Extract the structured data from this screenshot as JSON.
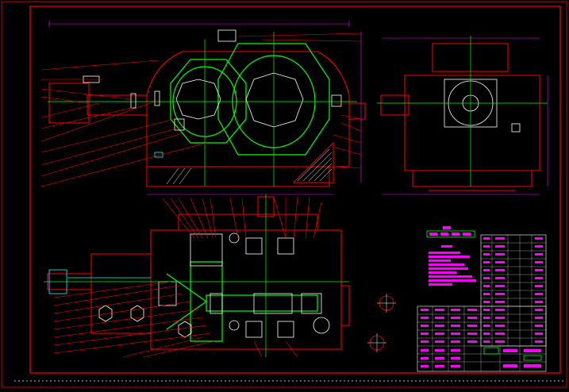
{
  "drawing": {
    "background": "#000000",
    "colors": {
      "frame": "#ff0000",
      "outline": "#ff0000",
      "gear": "#00ff00",
      "center_line": "#00ff00",
      "dimension": "#ff00ff",
      "hidden": "#00ffff",
      "white": "#ffffff",
      "yellow": "#ffff00"
    },
    "views": [
      "front-elevation",
      "side-elevation",
      "plan-section",
      "technical-requirements",
      "parts-list",
      "title-block"
    ]
  }
}
